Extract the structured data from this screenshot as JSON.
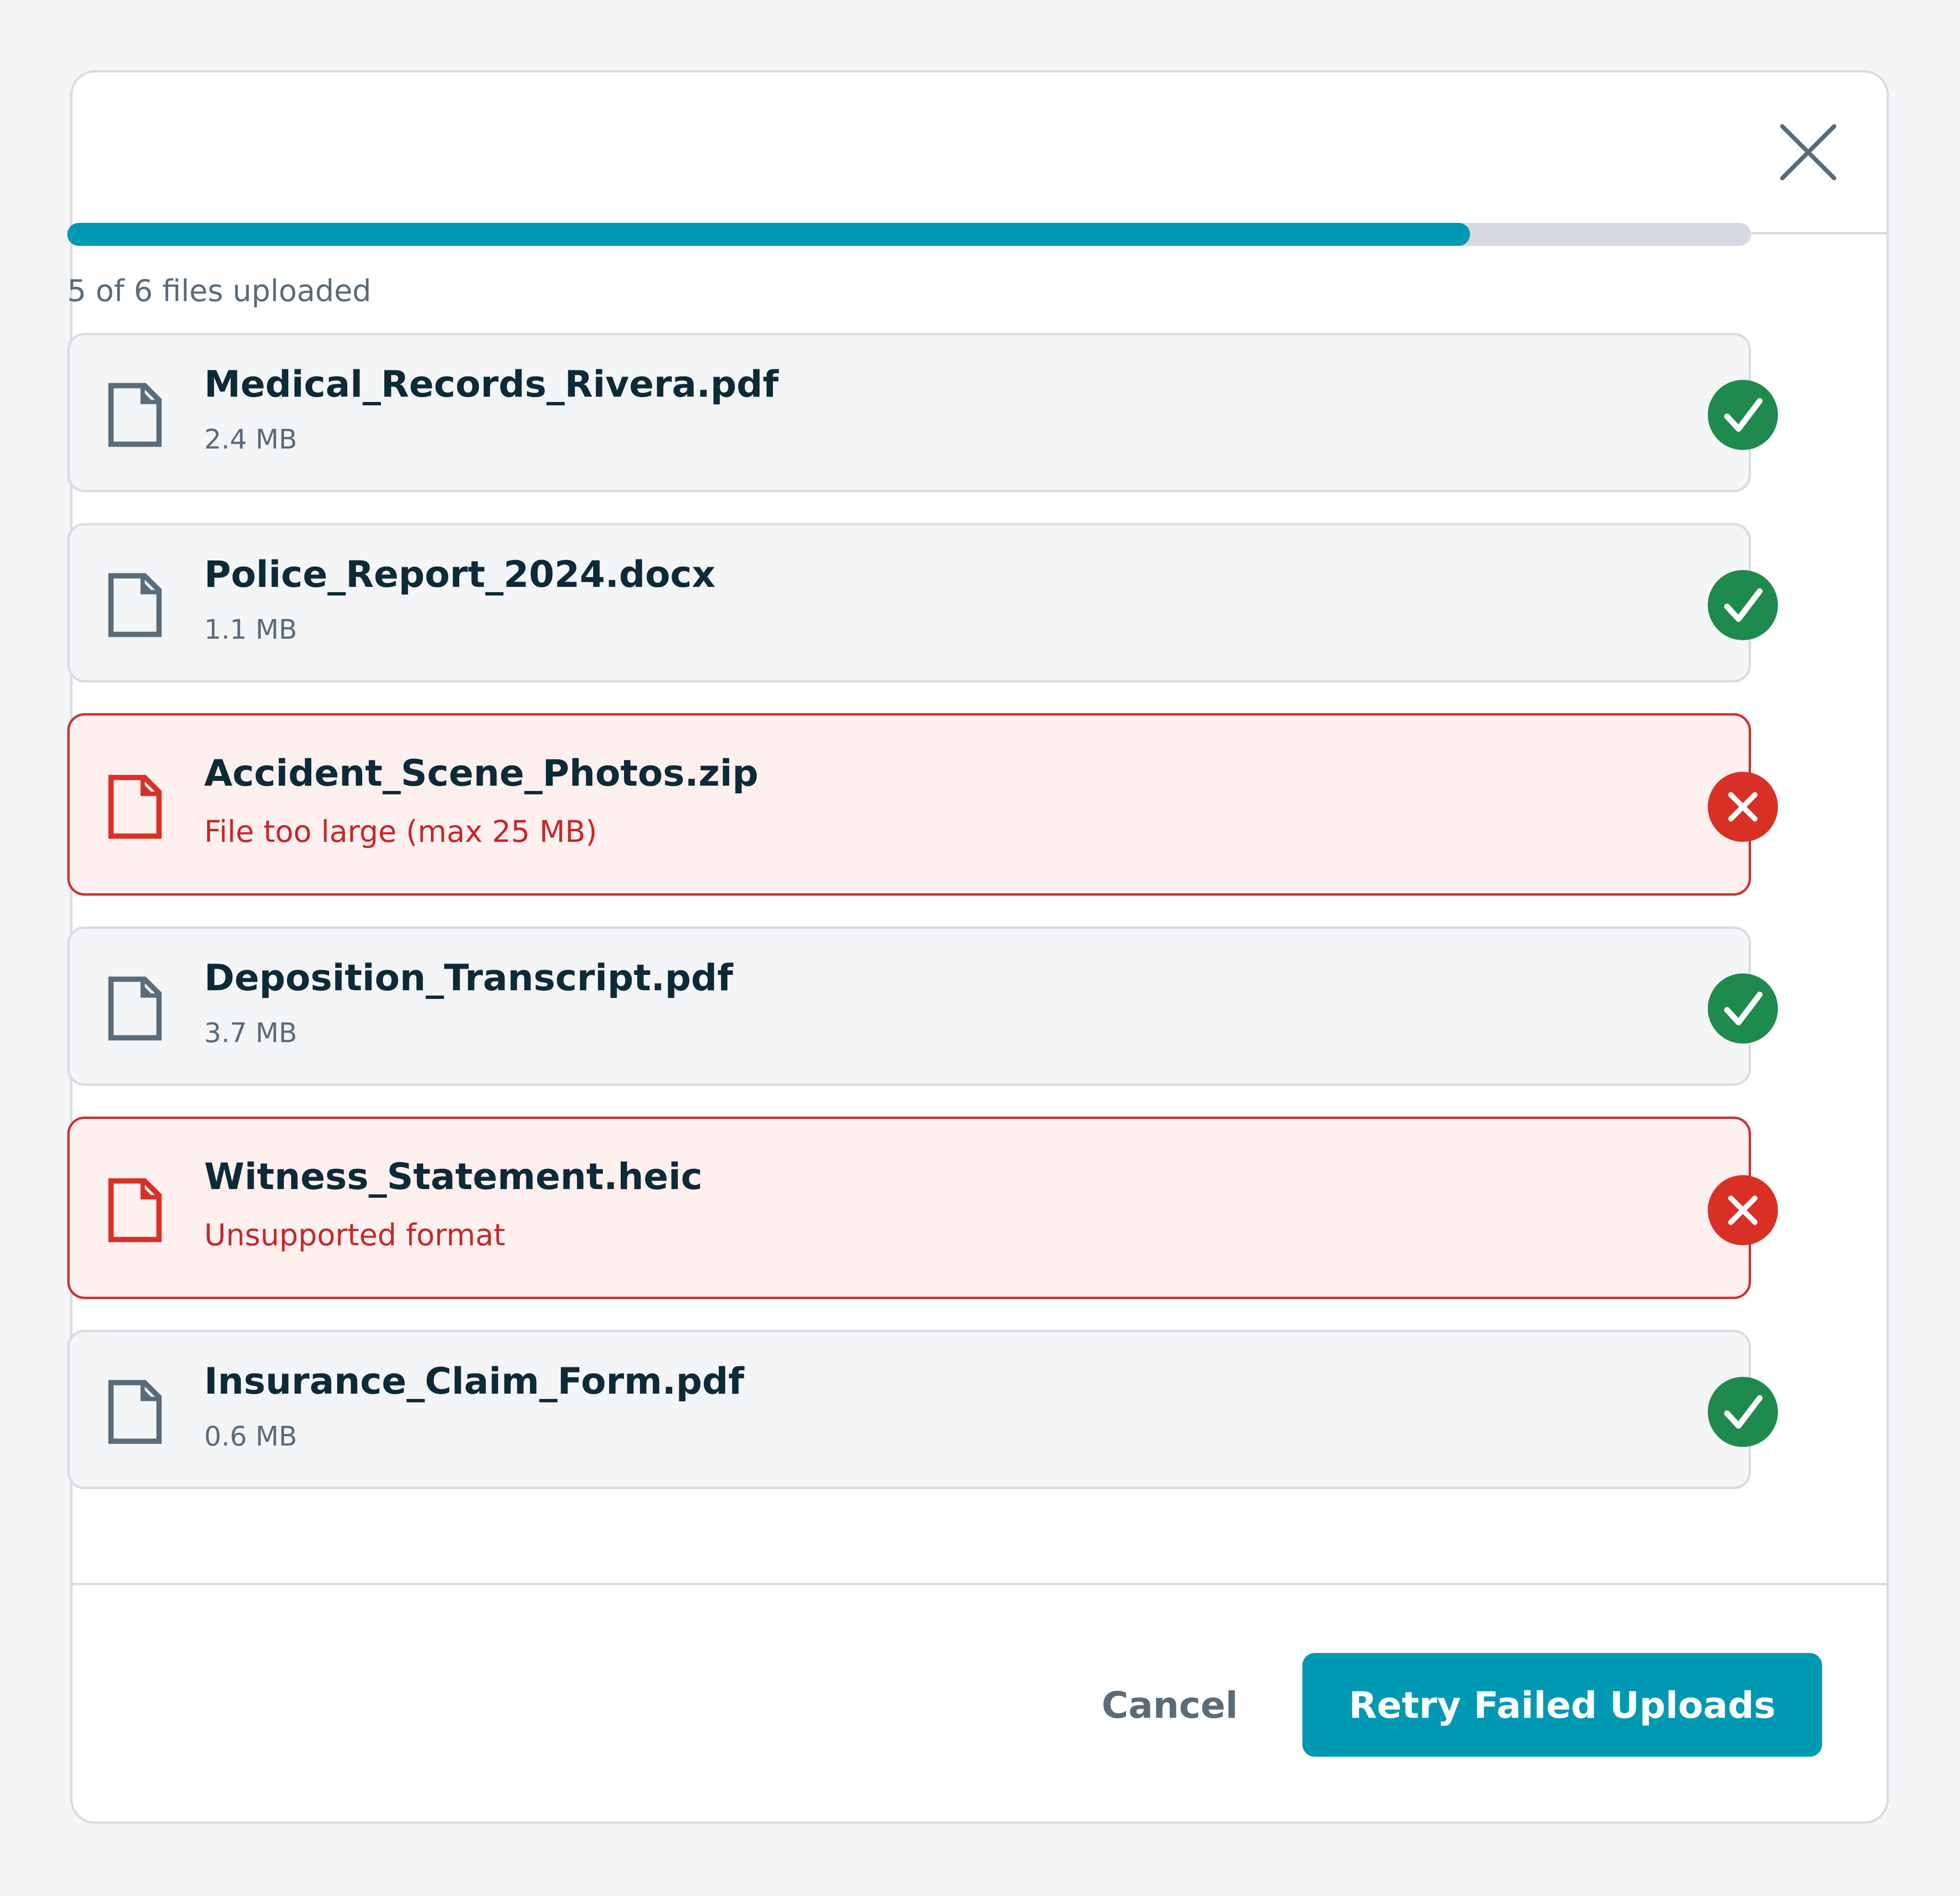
{
  "dialog": {
    "close_icon": "close-icon"
  },
  "upload": {
    "progress_fraction": 0.833,
    "progress_label": "5 of 6 files uploaded"
  },
  "files": [
    {
      "name": "Medical_Records_Rivera.pdf",
      "detail": "2.4 MB",
      "status": "success"
    },
    {
      "name": "Police_Report_2024.docx",
      "detail": "1.1 MB",
      "status": "success"
    },
    {
      "name": "Accident_Scene_Photos.zip",
      "detail": "File too large (max 25 MB)",
      "status": "error"
    },
    {
      "name": "Deposition_Transcript.pdf",
      "detail": "3.7 MB",
      "status": "success"
    },
    {
      "name": "Witness_Statement.heic",
      "detail": "Unsupported format",
      "status": "error"
    },
    {
      "name": "Insurance_Claim_Form.pdf",
      "detail": "0.6 MB",
      "status": "success"
    }
  ],
  "footer": {
    "cancel_label": "Cancel",
    "retry_label": "Retry Failed Uploads"
  },
  "colors": {
    "accent": "#0099b4",
    "success": "#1e8a4c",
    "error": "#d93025",
    "file_icon_default": "#5a6b7a",
    "file_icon_error": "#d93025"
  },
  "icons": {
    "file": "file-icon",
    "success": "check-circle-icon",
    "error": "x-circle-icon"
  }
}
